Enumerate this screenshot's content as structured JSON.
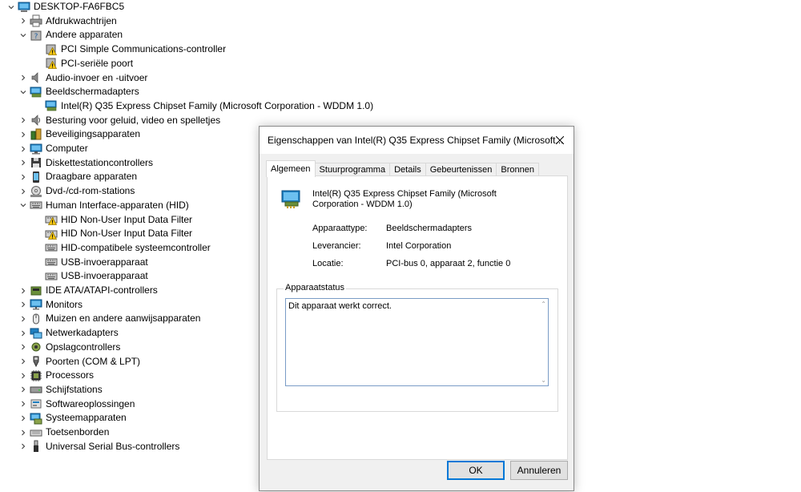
{
  "tree": {
    "root": "DESKTOP-FA6FBC5",
    "items": [
      {
        "label": "Afdrukwachtrijen",
        "icon": "printer-queue-icon",
        "expanded": false
      },
      {
        "label": "Andere apparaten",
        "icon": "unknown-device-icon",
        "expanded": true,
        "children": [
          {
            "label": "PCI Simple Communications-controller",
            "icon": "warning-device-icon"
          },
          {
            "label": "PCI-seriële poort",
            "icon": "warning-device-icon"
          }
        ]
      },
      {
        "label": "Audio-invoer en -uitvoer",
        "icon": "speaker-icon",
        "expanded": false
      },
      {
        "label": "Beeldschermadapters",
        "icon": "display-adapter-icon",
        "expanded": true,
        "children": [
          {
            "label": "Intel(R) Q35 Express Chipset Family (Microsoft Corporation - WDDM 1.0)",
            "icon": "display-adapter-icon"
          }
        ]
      },
      {
        "label": "Besturing voor geluid, video en spelletjes",
        "icon": "sound-icon",
        "expanded": false
      },
      {
        "label": "Beveiligingsapparaten",
        "icon": "security-device-icon",
        "expanded": false
      },
      {
        "label": "Computer",
        "icon": "computer-icon",
        "expanded": false
      },
      {
        "label": "Diskettestationcontrollers",
        "icon": "floppy-controller-icon",
        "expanded": false
      },
      {
        "label": "Draagbare apparaten",
        "icon": "portable-device-icon",
        "expanded": false
      },
      {
        "label": "Dvd-/cd-rom-stations",
        "icon": "dvd-icon",
        "expanded": false
      },
      {
        "label": "Human Interface-apparaten (HID)",
        "icon": "hid-icon",
        "expanded": true,
        "children": [
          {
            "label": "HID Non-User Input Data Filter",
            "icon": "hid-warning-icon"
          },
          {
            "label": "HID Non-User Input Data Filter",
            "icon": "hid-warning-icon"
          },
          {
            "label": "HID-compatibele systeemcontroller",
            "icon": "hid-icon"
          },
          {
            "label": "USB-invoerapparaat",
            "icon": "hid-icon"
          },
          {
            "label": "USB-invoerapparaat",
            "icon": "hid-icon"
          }
        ]
      },
      {
        "label": "IDE ATA/ATAPI-controllers",
        "icon": "ide-controller-icon",
        "expanded": false
      },
      {
        "label": "Monitors",
        "icon": "monitor-icon",
        "expanded": false
      },
      {
        "label": "Muizen en andere aanwijsapparaten",
        "icon": "mouse-icon",
        "expanded": false
      },
      {
        "label": "Netwerkadapters",
        "icon": "network-adapter-icon",
        "expanded": false
      },
      {
        "label": "Opslagcontrollers",
        "icon": "storage-controller-icon",
        "expanded": false
      },
      {
        "label": "Poorten (COM & LPT)",
        "icon": "port-icon",
        "expanded": false
      },
      {
        "label": "Processors",
        "icon": "processor-icon",
        "expanded": false
      },
      {
        "label": "Schijfstations",
        "icon": "disk-drive-icon",
        "expanded": false
      },
      {
        "label": "Softwareoplossingen",
        "icon": "software-component-icon",
        "expanded": false
      },
      {
        "label": "Systeemapparaten",
        "icon": "system-device-icon",
        "expanded": false
      },
      {
        "label": "Toetsenborden",
        "icon": "keyboard-icon",
        "expanded": false
      },
      {
        "label": "Universal Serial Bus-controllers",
        "icon": "usb-icon",
        "expanded": false
      }
    ]
  },
  "dialog": {
    "title": "Eigenschappen van Intel(R) Q35 Express Chipset Family (Microsoft...",
    "tabs": [
      "Algemeen",
      "Stuurprogramma",
      "Details",
      "Gebeurtenissen",
      "Bronnen"
    ],
    "active_tab": "Algemeen",
    "device_name": "Intel(R) Q35 Express Chipset Family (Microsoft Corporation - WDDM 1.0)",
    "props": {
      "type_label": "Apparaattype:",
      "type_value": "Beeldschermadapters",
      "vendor_label": "Leverancier:",
      "vendor_value": "Intel Corporation",
      "location_label": "Locatie:",
      "location_value": "PCI-bus 0, apparaat 2, functie 0"
    },
    "status_group_title": "Apparaatstatus",
    "status_text": "Dit apparaat werkt correct.",
    "ok_label": "OK",
    "cancel_label": "Annuleren"
  },
  "colors": {
    "accent": "#0078d7",
    "warning": "#f2c511"
  }
}
